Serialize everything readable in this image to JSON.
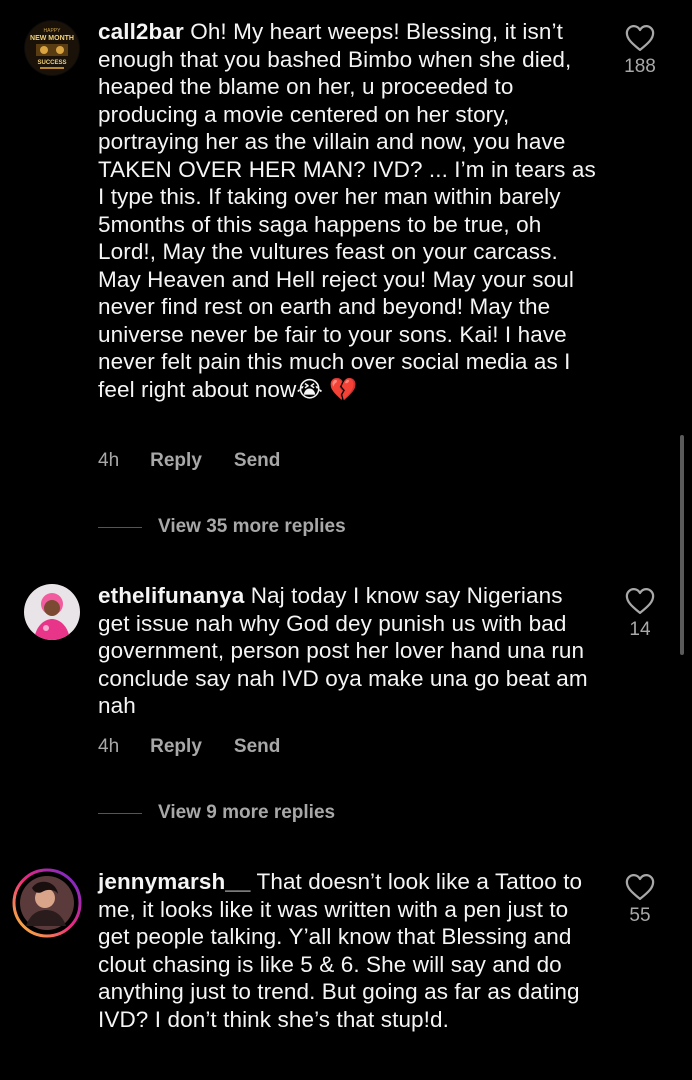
{
  "comments": [
    {
      "username": "call2bar",
      "text": "Oh! My heart weeps! Blessing, it isn’t enough that you bashed Bimbo when she died, heaped the blame on her, u proceeded to producing a movie centered on her story, portraying her as the villain and now, you have TAKEN OVER HER MAN? IVD? ...  I’m in tears as I type this. If taking over her man within barely 5months of this saga happens to be true, oh Lord!, May the vultures feast on your carcass. May Heaven and Hell reject you! May your soul never find rest on earth and beyond!  May the universe never be fair to your sons. Kai! I have never felt pain this much over social media as I feel right about now😭 💔",
      "time": "4h",
      "reply_label": "Reply",
      "send_label": "Send",
      "likes": "188",
      "view_more": "View 35 more replies",
      "avatar_text_top": "NEW MONTH",
      "avatar_text_bottom": "SUCCESS"
    },
    {
      "username": "ethelifunanya",
      "text": "Naj today I know say Nigerians get issue nah why God dey punish us with bad government, person post her lover hand una run conclude say nah IVD oya make una go beat am nah",
      "time": "4h",
      "reply_label": "Reply",
      "send_label": "Send",
      "likes": "14",
      "view_more": "View 9 more replies"
    },
    {
      "username": "jennymarsh__",
      "text": "That doesn’t look like a Tattoo to me, it looks like it was written with a pen just to get people talking. Y’all know that Blessing and clout chasing is like 5 & 6. She will say and do anything just to trend. But going as far as dating IVD? I don’t think she’s that stup!d.",
      "likes": "55"
    }
  ],
  "colors": {
    "background": "#000000",
    "text": "#f5f5f5",
    "muted": "#a8a8a8",
    "story_ring_start": "#f9ce34",
    "story_ring_end": "#ee2a7b"
  },
  "icons": {
    "like": "heart-outline-icon"
  }
}
